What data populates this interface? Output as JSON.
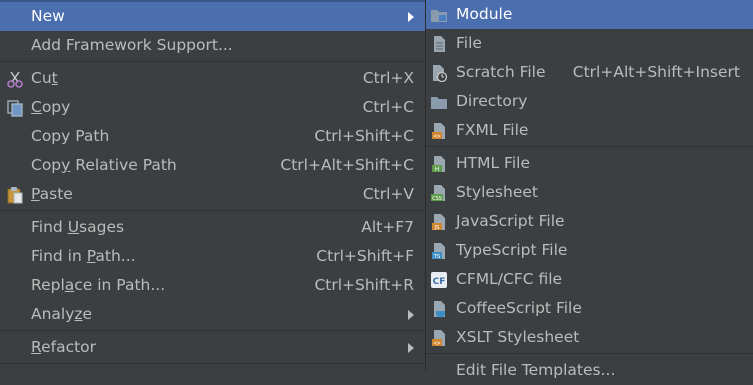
{
  "main_menu": {
    "new": {
      "pre": "",
      "ul": "N",
      "post": "ew"
    },
    "add_framework": {
      "pre": "Add Framework Support...",
      "ul": "",
      "post": ""
    },
    "cut": {
      "pre": "Cu",
      "ul": "t",
      "post": "",
      "shortcut": "Ctrl+X"
    },
    "copy": {
      "pre": "",
      "ul": "C",
      "post": "opy",
      "shortcut": "Ctrl+C"
    },
    "copy_path": {
      "pre": "Copy Path",
      "ul": "",
      "post": "",
      "shortcut": "Ctrl+Shift+C"
    },
    "copy_relative": {
      "pre": "Cop",
      "ul": "y",
      "post": " Relative Path",
      "shortcut": "Ctrl+Alt+Shift+C"
    },
    "paste": {
      "pre": "",
      "ul": "P",
      "post": "aste",
      "shortcut": "Ctrl+V"
    },
    "find_usages": {
      "pre": "Find ",
      "ul": "U",
      "post": "sages",
      "shortcut": "Alt+F7"
    },
    "find_in_path": {
      "pre": "Find in ",
      "ul": "P",
      "post": "ath...",
      "shortcut": "Ctrl+Shift+F"
    },
    "replace_in_path": {
      "pre": "Repl",
      "ul": "a",
      "post": "ce in Path...",
      "shortcut": "Ctrl+Shift+R"
    },
    "analyze": {
      "pre": "Analy",
      "ul": "z",
      "post": "e"
    },
    "refactor": {
      "pre": "",
      "ul": "R",
      "post": "efactor"
    }
  },
  "sub_menu": {
    "module": "Module",
    "file": "File",
    "scratch_file": "Scratch File",
    "scratch_shortcut": "Ctrl+Alt+Shift+Insert",
    "directory": "Directory",
    "fxml_file": "FXML File",
    "html_file": "HTML File",
    "stylesheet": "Stylesheet",
    "javascript_file": "JavaScript File",
    "typescript_file": "TypeScript File",
    "cfml_file": "CFML/CFC file",
    "coffeescript_file": "CoffeeScript File",
    "xslt_stylesheet": "XSLT Stylesheet",
    "edit_templates": "Edit File Templates..."
  },
  "icons": {
    "cut": "scissors-icon",
    "copy": "copy-icon",
    "paste": "paste-icon",
    "module": "module-folder-icon",
    "file": "file-icon",
    "scratch": "scratch-file-icon",
    "directory": "folder-icon",
    "fxml": "fxml-file-icon",
    "html": "html-file-icon",
    "css": "stylesheet-icon",
    "js": "javascript-file-icon",
    "ts": "typescript-file-icon",
    "cfml": "cfml-file-icon",
    "coffee": "coffeescript-file-icon",
    "xslt": "xslt-file-icon"
  },
  "colors": {
    "menu_bg": "#3c3f41",
    "selection": "#4b6eaf",
    "text": "#bbbbbb",
    "separator": "#2f3133",
    "folder": "#8a9bad"
  }
}
